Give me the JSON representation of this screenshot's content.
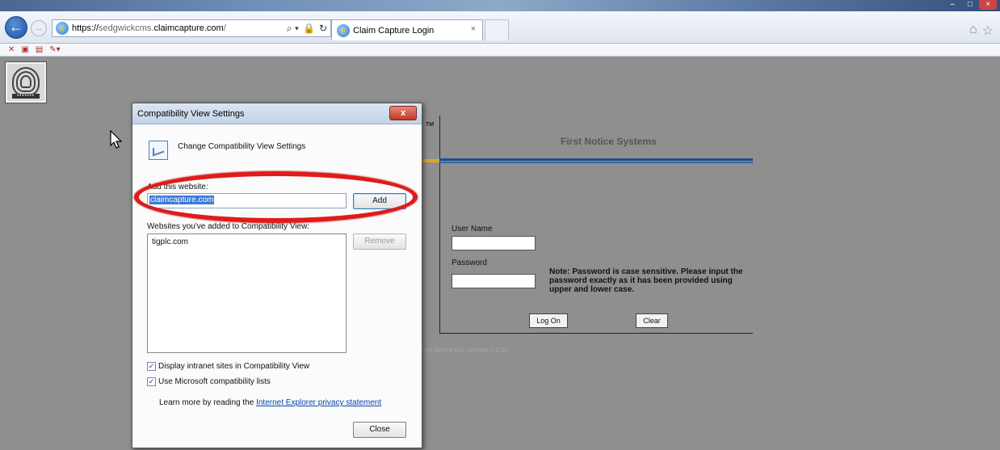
{
  "browser": {
    "url_prefix": "https://",
    "url_host_gray": "sedgwickcms.",
    "url_host": "claimcapture.com",
    "url_suffix": "/",
    "tab_title": "Claim Capture Login",
    "tab_close": "×",
    "search_glyph": "⌕ ▾",
    "lock_glyph": "🔒",
    "refresh_glyph": "↻",
    "home_glyph": "⌂",
    "star_glyph": "☆",
    "titlebar_min": "–",
    "titlebar_max": "□",
    "titlebar_close": "×"
  },
  "page": {
    "tm": "TM",
    "title": "First Notice Systems",
    "username_label": "User Name",
    "password_label": "Password",
    "note": "Note: Password is case sensitive. Please input the password exactly as it has been provided using upper and lower case.",
    "logon_label": "Log On",
    "clear_label": "Clear",
    "footer": "First Notice Inc. Version 7.2.10",
    "fingerprint_dots": "•••••••"
  },
  "dialog": {
    "title": "Compatibility View Settings",
    "close_glyph": "x",
    "heading": "Change Compatibility View Settings",
    "add_label": "Add this website:",
    "site_value": "claimcapture.com",
    "add_button": "Add",
    "list_label": "Websites you've added to Compatibility View:",
    "list_items": [
      "tigplc.com"
    ],
    "remove_button": "Remove",
    "check1_label": "Display intranet sites in Compatibility View",
    "check2_label": "Use Microsoft compatibility lists",
    "learn_text": "Learn more by reading the ",
    "learn_link": "Internet Explorer privacy statement",
    "close_button": "Close",
    "check_glyph": "✓"
  },
  "colors": {
    "highlight_ring": "#e01b1b",
    "page_background": "#8f8f8f",
    "stripe_blue": "#1d4f8a",
    "stripe_orange": "#e1a326"
  }
}
